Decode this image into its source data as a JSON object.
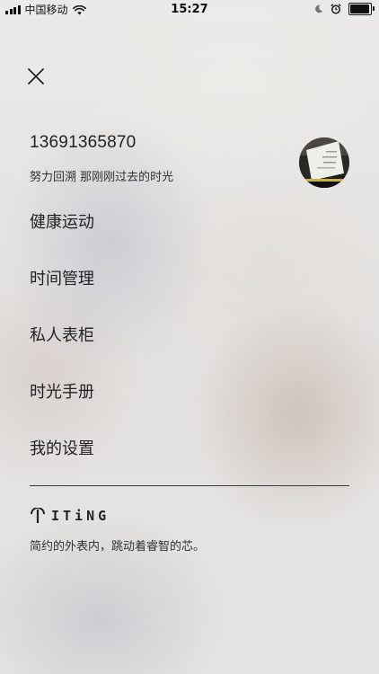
{
  "status_bar": {
    "carrier": "中国移动",
    "time": "15:27",
    "battery_level": 0.95
  },
  "profile": {
    "phone": "13691365870",
    "motto": "努力回溯 那刚刚过去的时光"
  },
  "menu": {
    "items": [
      {
        "label": "健康运动"
      },
      {
        "label": "时间管理"
      },
      {
        "label": "私人表柜"
      },
      {
        "label": "时光手册"
      },
      {
        "label": "我的设置"
      }
    ]
  },
  "footer": {
    "brand": "ITiNG",
    "slogan": "简约的外表内，跳动着睿智的芯。"
  }
}
